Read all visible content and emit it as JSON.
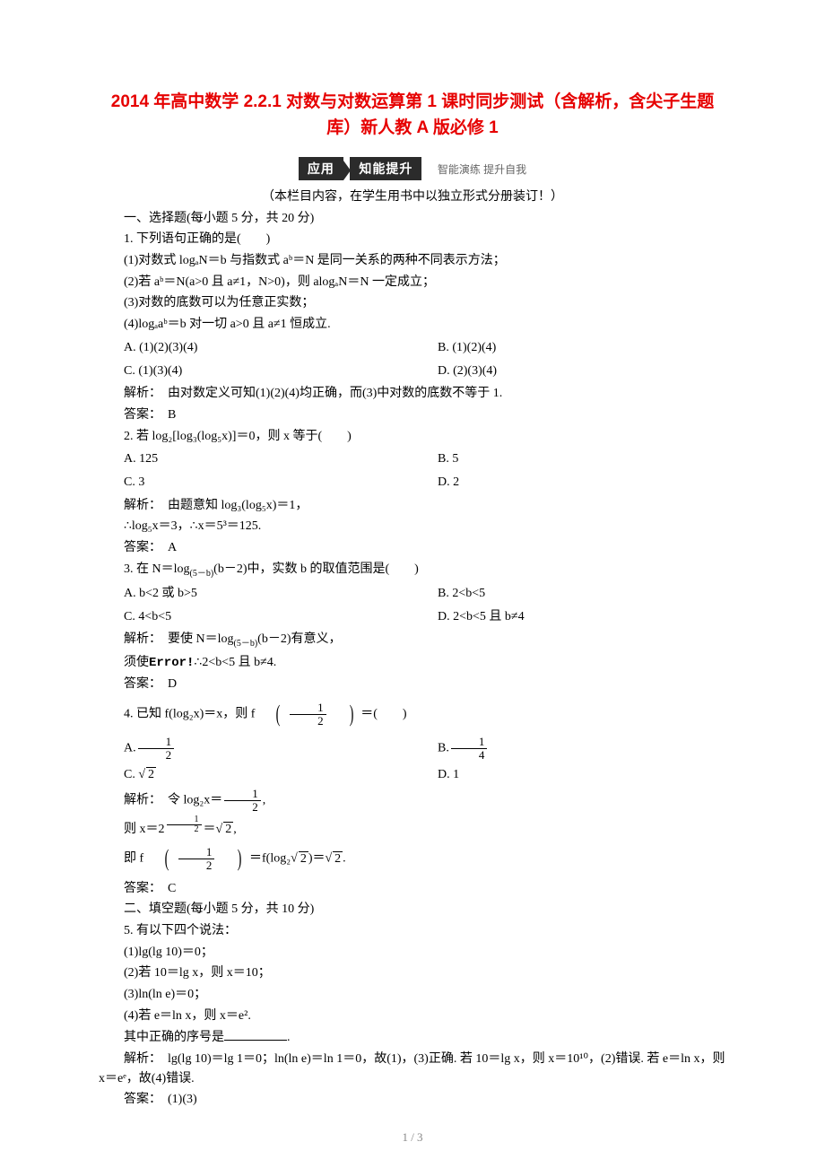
{
  "title": "2014 年高中数学 2.2.1 对数与对数运算第 1 课时同步测试（含解析，含尖子生题库）新人教 A 版必修 1",
  "banner": {
    "left": "应用",
    "right": "知能提升",
    "sub": "智能演练 提升自我"
  },
  "note": "（本栏目内容，在学生用书中以独立形式分册装订！）",
  "sec1_heading": "一、选择题(每小题 5 分，共 20 分)",
  "q1": {
    "stem": "1. 下列语句正确的是(　　)",
    "s1": "(1)对数式 logₐN＝b 与指数式 aᵇ＝N 是同一关系的两种不同表示方法；",
    "s2": "(2)若 aᵇ＝N(a>0 且 a≠1，N>0)，则 alogₐN＝N 一定成立；",
    "s3": "(3)对数的底数可以为任意正实数；",
    "s4": "(4)logₐaᵇ＝b 对一切 a>0 且 a≠1 恒成立.",
    "A": "A. (1)(2)(3)(4)",
    "B": "B. (1)(2)(4)",
    "C": "C. (1)(3)(4)",
    "D": "D. (2)(3)(4)",
    "exp": "解析：　由对数定义可知(1)(2)(4)均正确，而(3)中对数的底数不等于 1.",
    "ans": "答案：　B"
  },
  "q2": {
    "stem": "2. 若 log₂[log₃(log₅x)]＝0，则 x 等于(　　)",
    "A": "A. 125",
    "B": "B. 5",
    "C": "C. 3",
    "D": "D. 2",
    "exp1": "解析：　由题意知 log₃(log₅x)＝1，",
    "exp2": "∴log₅x＝3，∴x＝5³＝125.",
    "ans": "答案：　A"
  },
  "q3": {
    "stem_pre": "3. 在 N＝log",
    "stem_sub": "(5－b)",
    "stem_post": "(b－2)中，实数 b 的取值范围是(　　)",
    "A": "A. b<2 或 b>5",
    "B": "B. 2<b<5",
    "C": "C. 4<b<5",
    "D": "D. 2<b<5 且 b≠4",
    "exp1_pre": "解析：　要使 N＝log",
    "exp1_sub": "(5－b)",
    "exp1_post": "(b－2)有意义，",
    "exp2_pre": "须使",
    "exp2_err": "Error!",
    "exp2_post": "∴2<b<5 且 b≠4.",
    "ans": "答案：　D"
  },
  "q4": {
    "stem_pre": "4. 已知 f(log₂x)＝x，则 f",
    "frac_n": "1",
    "frac_d": "2",
    "stem_post": "＝(　　)",
    "A_pre": "A.",
    "A_n": "1",
    "A_d": "2",
    "B_pre": "B.",
    "B_n": "1",
    "B_d": "4",
    "C": "C. √2",
    "D": "D. 1",
    "exp1_pre": "解析：　令 log₂x＝",
    "exp1_n": "1",
    "exp1_d": "2",
    "exp1_post": ",",
    "exp2_pre": "则 x＝2",
    "exp2_n": "1",
    "exp2_d": "2",
    "exp2_mid": "＝",
    "exp2_sqrt": "2",
    "exp2_post": ",",
    "exp3_pre": "即 f",
    "exp3_n": "1",
    "exp3_d": "2",
    "exp3_mid": "＝f(log₂",
    "exp3_sqrt1": "2",
    "exp3_mid2": ")＝",
    "exp3_sqrt2": "2",
    "exp3_post": ".",
    "ans": "答案：　C"
  },
  "sec2_heading": "二、填空题(每小题 5 分，共 10 分)",
  "q5": {
    "stem": "5. 有以下四个说法：",
    "s1": "(1)lg(lg 10)＝0；",
    "s2": "(2)若 10＝lg x，则 x＝10；",
    "s3": "(3)ln(ln e)＝0；",
    "s4": "(4)若 e＝ln x，则 x＝e².",
    "tail": "其中正确的序号是",
    "exp": "解析：　lg(lg 10)＝lg 1＝0；ln(ln e)＝ln 1＝0，故(1)，(3)正确. 若 10＝lg x，则 x＝10¹⁰，(2)错误. 若 e＝ln x，则 x＝eᵉ，故(4)错误.",
    "ans": "答案：　(1)(3)"
  },
  "page_number": "1 / 3"
}
